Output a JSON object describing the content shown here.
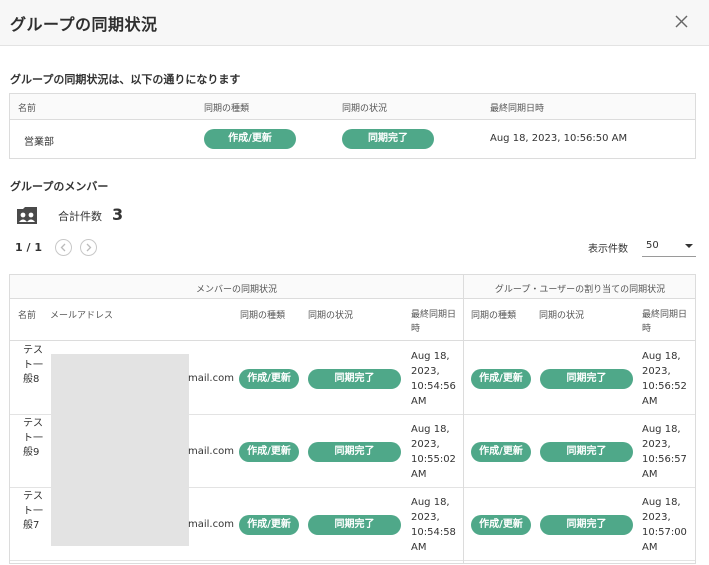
{
  "dialog": {
    "title": "グループの同期状況"
  },
  "group_status": {
    "heading": "グループの同期状況は、以下の通りになります",
    "columns": [
      "名前",
      "同期の種類",
      "同期の状況",
      "最終同期日時"
    ],
    "row": {
      "name": "営業部",
      "sync_type": "作成/更新",
      "sync_status": "同期完了",
      "last_sync": "Aug 18, 2023, 10:56:50 AM"
    }
  },
  "members": {
    "heading": "グループのメンバー",
    "total_label": "合計件数",
    "total_value": "3",
    "pager": {
      "text": "1 / 1"
    },
    "per_page": {
      "label": "表示件数",
      "value": "50"
    },
    "table": {
      "group_headers": [
        "メンバーの同期状況",
        "グループ・ユーザーの割り当ての同期状況"
      ],
      "columns": [
        "名前",
        "メールアドレス",
        "同期の種類",
        "同期の状況",
        "最終同期日時",
        "同期の種類",
        "同期の状況",
        "最終同期日時"
      ],
      "rows": [
        {
          "name": "テスト一般8",
          "email": "mail.com",
          "type1": "作成/更新",
          "status1": "同期完了",
          "date1": "Aug 18, 2023, 10:54:56 AM",
          "type2": "作成/更新",
          "status2": "同期完了",
          "date2": "Aug 18, 2023, 10:56:52 AM"
        },
        {
          "name": "テスト一般9",
          "email": "mail.com",
          "type1": "作成/更新",
          "status1": "同期完了",
          "date1": "Aug 18, 2023, 10:55:02 AM",
          "type2": "作成/更新",
          "status2": "同期完了",
          "date2": "Aug 18, 2023, 10:56:57 AM"
        },
        {
          "name": "テスト一般7",
          "email": "mail.com",
          "type1": "作成/更新",
          "status1": "同期完了",
          "date1": "Aug 18, 2023, 10:54:58 AM",
          "type2": "作成/更新",
          "status2": "同期完了",
          "date2": "Aug 18, 2023, 10:57:00 AM"
        }
      ]
    }
  },
  "icons": {
    "close": "close-icon",
    "members": "member-card-icon",
    "prev": "chevron-left-icon",
    "next": "chevron-right-icon",
    "dropdown": "caret-down-icon"
  },
  "colors": {
    "accent": "#4fa889"
  }
}
